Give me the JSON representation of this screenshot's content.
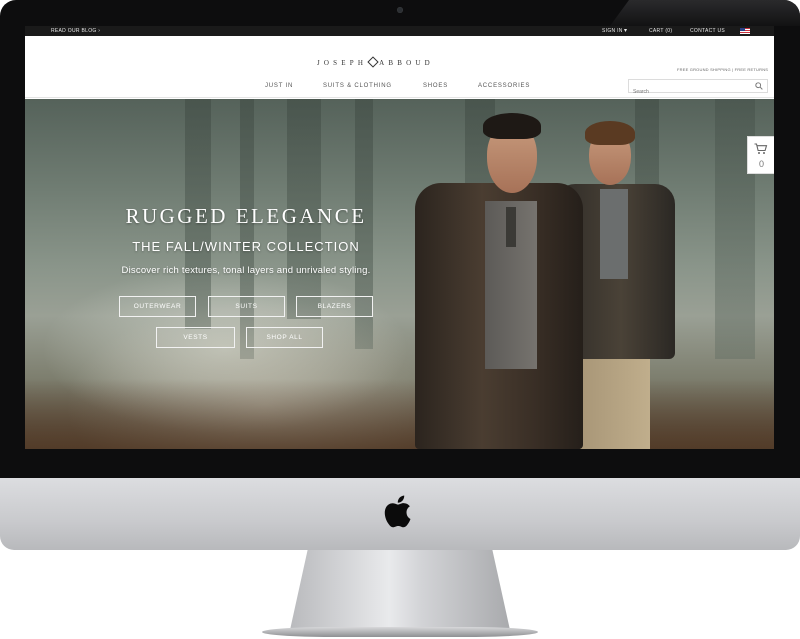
{
  "topbar": {
    "blog_link": "READ OUR BLOG ›",
    "sign_in": "SIGN IN",
    "cart": "CART (0)",
    "contact": "CONTACT US"
  },
  "header": {
    "logo_left": "JOSEPH",
    "logo_right": "ABBOUD",
    "shipping_note": "FREE GROUND SHIPPING | FREE RETURNS"
  },
  "nav": {
    "items": [
      "JUST IN",
      "SUITS & CLOTHING",
      "SHOES",
      "ACCESSORIES"
    ]
  },
  "search": {
    "placeholder": "Search"
  },
  "hero": {
    "headline": "RUGGED ELEGANCE",
    "subhead": "THE FALL/WINTER COLLECTION",
    "tagline": "Discover rich textures, tonal layers and unrivaled styling.",
    "buttons": [
      "OUTERWEAR",
      "SUITS",
      "BLAZERS",
      "VESTS",
      "SHOP ALL"
    ]
  },
  "cart_widget": {
    "count": "0"
  },
  "icons": [
    "apple-logo-icon",
    "search-icon",
    "cart-icon",
    "flag-icon",
    "dropdown-caret-icon",
    "logo-diamond-icon"
  ],
  "colors": {
    "topbar": "#1a1a1a",
    "bezel": "#0d0d0e",
    "chin": "#cfd0d3"
  }
}
